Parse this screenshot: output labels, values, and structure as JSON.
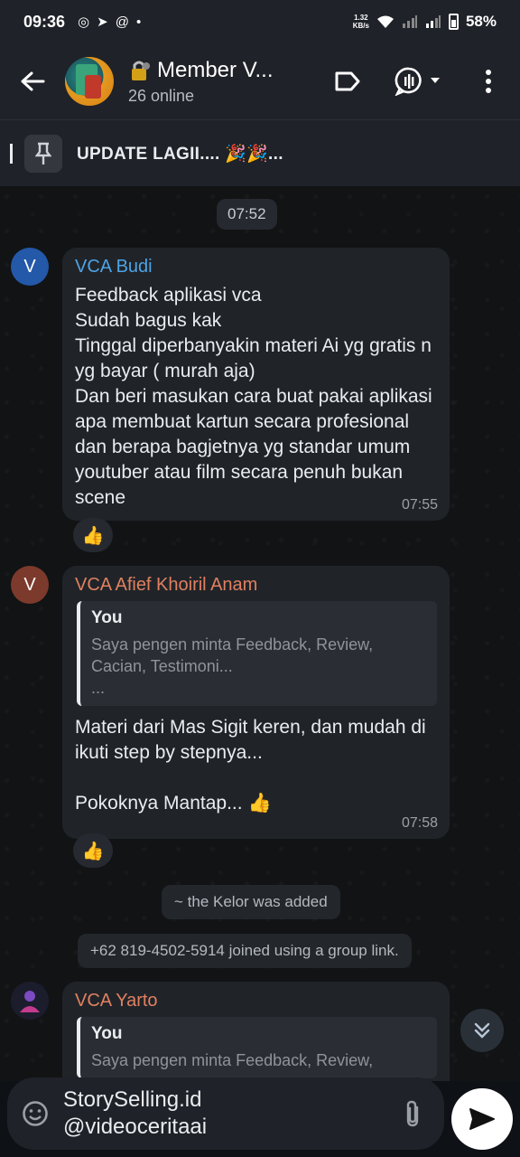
{
  "status": {
    "time": "09:36",
    "net_speed_value": "1.32",
    "net_speed_unit": "KB/s",
    "battery": "58%"
  },
  "header": {
    "title": "Member V...",
    "subtitle": "26 online"
  },
  "pinned": {
    "text": "UPDATE LAGII.... 🎉🎉..."
  },
  "chat": {
    "date_chip": "07:52",
    "messages": [
      {
        "avatar_letter": "V",
        "sender": "VCA Budi",
        "text": "Feedback aplikasi vca\nSudah bagus kak\nTinggal diperbanyakin materi Ai yg gratis n yg bayar ( murah aja)\nDan beri masukan cara buat pakai aplikasi apa membuat kartun secara profesional dan berapa bagjetnya yg standar umum youtuber atau film secara penuh bukan scene",
        "time": "07:55",
        "reaction": "👍"
      },
      {
        "avatar_letter": "V",
        "sender": "VCA Afief Khoiril Anam",
        "quote_author": "You",
        "quote_text": "Saya pengen minta Feedback, Review, Cacian, Testimoni...\n...",
        "text": "Materi dari Mas Sigit keren, dan mudah di ikuti step by stepnya...\n\nPokoknya Mantap... 👍",
        "time": "07:58",
        "reaction": "👍"
      },
      {
        "sender": "VCA Yarto",
        "quote_author": "You",
        "quote_text": "Saya pengen minta Feedback, Review,"
      }
    ],
    "system": [
      "~ the Kelor was added",
      "+62 819-4502-5914 joined using a group link."
    ]
  },
  "composer": {
    "text": "StorySelling.id\n@videoceritaai"
  },
  "icons": [
    "back-arrow-icon",
    "label-icon",
    "voice-chat-icon",
    "more-vert-icon",
    "pin-icon",
    "emoji-icon",
    "attach-icon",
    "send-icon",
    "chevron-double-down-icon"
  ]
}
